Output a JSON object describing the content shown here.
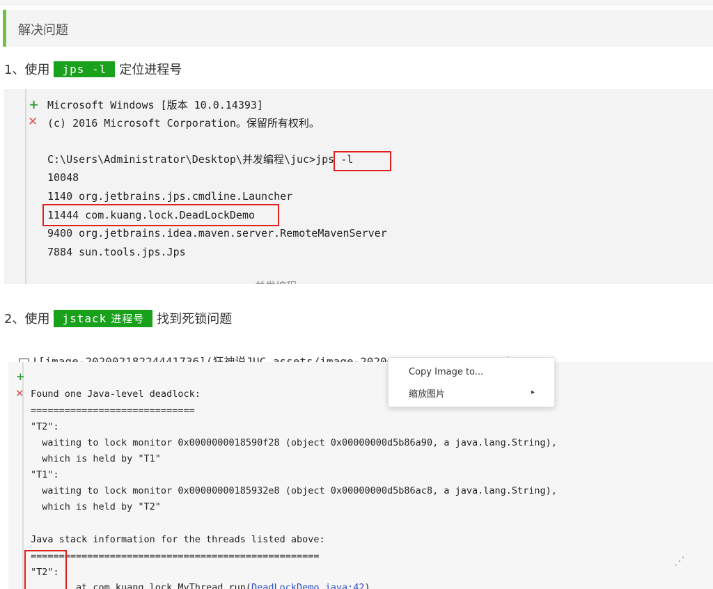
{
  "section_header": "解决问题",
  "step1": {
    "prefix": "1、使用",
    "badge": "jps -l",
    "suffix": "定位进程号"
  },
  "terminal": {
    "lines": [
      "Microsoft Windows [版本 10.0.14393]",
      "(c) 2016 Microsoft Corporation。保留所有权利。",
      "C:\\Users\\Administrator\\Desktop\\并发编程\\juc>jps -l",
      "10048",
      "1140 org.jetbrains.jps.cmdline.Launcher",
      "11444 com.kuang.lock.DeadLockDemo",
      "9400 org.jetbrains.idea.maven.server.RemoteMavenServer",
      "7884 sun.tools.jps.Jps",
      "并发编程"
    ],
    "plus_icon": "+",
    "cross_icon": "✕"
  },
  "step2": {
    "prefix": "2、使用",
    "badge_code": "jstack",
    "badge_cn": "进程号",
    "suffix": "找到死锁问题"
  },
  "image_ref": "![image-20200218224441736](狂神说JUC.assets/image-20200218224441736.png)",
  "context_menu": {
    "items": [
      "Copy Image to...",
      "缩放图片"
    ],
    "submenu_arrow": "▸"
  },
  "deadlock": {
    "plus_icon": "+",
    "cross_icon": "✕",
    "lines": [
      "Found one Java-level deadlock:",
      "=============================",
      "\"T2\":",
      "  waiting to lock monitor 0x0000000018590f28 (object 0x00000000d5b86a90, a java.lang.String),",
      "  which is held by \"T1\"",
      "\"T1\":",
      "  waiting to lock monitor 0x00000000185932e8 (object 0x00000000d5b86ac8, a java.lang.String),",
      "  which is held by \"T2\"",
      "Java stack information for the threads listed above:",
      "===================================================",
      "\"T2\":",
      "        at com.kuang.lock.MyThread.run("
    ],
    "link": "DeadLockDemo.java:42",
    "link_close": ")"
  }
}
